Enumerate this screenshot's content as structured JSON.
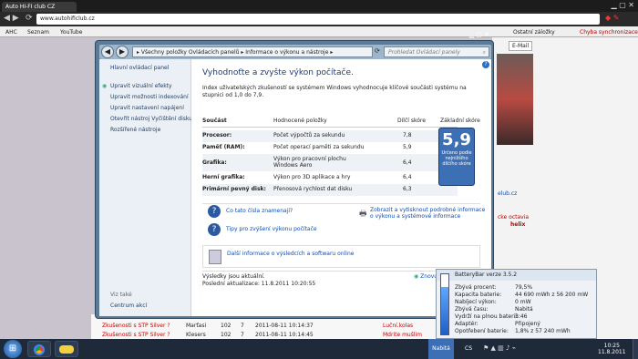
{
  "chrome": {
    "tab_title": "Auto HI-FI club CZ",
    "url": "www.autohificlub.cz",
    "bookmarks": [
      "AHC",
      "Seznam",
      "YouTube"
    ],
    "bookmarks_right": [
      "Ostatní záložky",
      "Chyba synchronizace"
    ]
  },
  "control_panel": {
    "breadcrumb": "▸ Všechny položky Ovládacích panelů ▸ Informace o výkonu a nástroje ▸",
    "search_placeholder": "Prohledat Ovládací panely",
    "sidebar": {
      "home": "Hlavní ovládací panel",
      "links": [
        "Upravit vizuální efekty",
        "Upravit možnosti indexování",
        "Upravit nastavení napájení",
        "Otevřít nástroj Vyčištění disku",
        "Rozšířené nástroje"
      ],
      "see_also": "Viz také",
      "action_center": "Centrum akcí"
    },
    "heading": "Vyhodnoťte a zvyšte výkon počítače.",
    "intro": "Index uživatelských zkušeností se systémem Windows vyhodnocuje klíčové součásti systému na stupnici od 1,0 do 7,9.",
    "table_headers": [
      "Součást",
      "Hodnocené položky",
      "Dílčí skóre",
      "Základní skóre"
    ],
    "rows": [
      {
        "component": "Procesor:",
        "item": "Počet výpočtů za sekundu",
        "score": "7,8"
      },
      {
        "component": "Paměť (RAM):",
        "item": "Počet operací paměti za sekundu",
        "score": "5,9"
      },
      {
        "component": "Grafika:",
        "item": "Výkon pro pracovní plochu Windows Aero",
        "score": "6,4"
      },
      {
        "component": "Herní grafika:",
        "item": "Výkon pro 3D aplikace a hry",
        "score": "6,4"
      },
      {
        "component": "Primární pevný disk:",
        "item": "Přenosová rychlost dat disku",
        "score": "6,3"
      }
    ],
    "base_score": "5,9",
    "base_score_caption": "Určeno podle nejnižšího dílčího skóre",
    "help_links": [
      "Co tato čísla znamenají?",
      "Tipy pro zvýšení výkonu počítače"
    ],
    "print_link": "Zobrazit a vytisknout podrobné informace o výkonu a systémové informace",
    "more_info_link": "Další informace o výsledcích a softwaru online",
    "results_current": "Výsledky jsou aktuální.",
    "last_update": "Poslední aktualizace: 11.8.2011 10:20:55",
    "refresh": "Znovu"
  },
  "page": {
    "email": "E-Mail",
    "side_snippets": [
      "elub.cz",
      "cke octavia",
      "helix"
    ],
    "bottom_rows": [
      {
        "title": "Zkušenosti s STP Silver ?",
        "user": "Marťasi",
        "a": "102",
        "b": "7",
        "date": "2011-08-11 10:14:37",
        "c": "Luční.kolas"
      },
      {
        "title": "Zkušenosti s STP Silver ?",
        "user": "Klesers",
        "a": "102",
        "b": "7",
        "date": "2011-08-11 10:14:45",
        "c": "Mdrite mušlim"
      }
    ]
  },
  "batterybar": {
    "title": "BatteryBar verze 3.5.2",
    "fields": [
      {
        "label": "Zbývá procent:",
        "value": "79,5%"
      },
      {
        "label": "Kapacita baterie:",
        "value": "44 690 mWh z 56 200 mW"
      },
      {
        "label": "Nabíjecí výkon:",
        "value": "0 mW"
      },
      {
        "label": "Zbývá času:",
        "value": "Nabitá"
      },
      {
        "label": "Vydrží na plnou baterii:",
        "value": "3:46"
      },
      {
        "label": "Adaptér:",
        "value": "Připojený"
      },
      {
        "label": "Opotřebení baterie:",
        "value": "1,8% z 57 240 mWh"
      }
    ],
    "level_percent": 79.5
  },
  "taskbar": {
    "battery_label": "Nabitá",
    "lang": "CS",
    "time": "10:25",
    "date": "11.8.2011"
  },
  "colors": {
    "accent": "#1a3c7a",
    "link": "#0b4cb3",
    "score_box": "#3d6fb5"
  }
}
